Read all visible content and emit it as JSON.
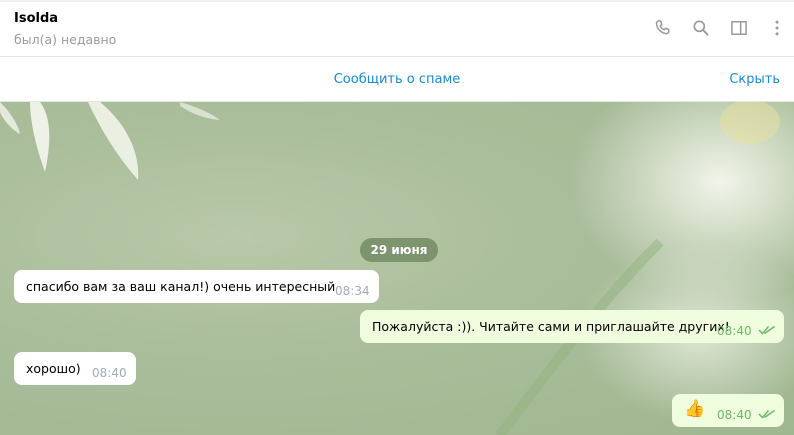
{
  "header": {
    "name": "Isolda",
    "status": "был(а) недавно",
    "icons": [
      "phone-icon",
      "search-icon",
      "sidebar-panel-icon",
      "more-vertical-icon"
    ]
  },
  "spam_bar": {
    "report_label": "Сообщить о спаме",
    "hide_label": "Скрыть"
  },
  "chat": {
    "date_label": "29 июня",
    "messages": [
      {
        "direction": "in",
        "text": "спасибо вам за ваш канал!) очень интересный",
        "time": "08:34"
      },
      {
        "direction": "out",
        "text": "Пожалуйста :)). Читайте сами и приглашайте других!",
        "time": "08:40",
        "read": true
      },
      {
        "direction": "in",
        "text": "хорошо)",
        "time": "08:40"
      },
      {
        "direction": "out",
        "text": "👍",
        "time": "08:40",
        "read": true,
        "emoji": "thumbs-up"
      }
    ]
  },
  "colors": {
    "link": "#168acd",
    "outgoing_bubble": "#effdde",
    "incoming_bubble": "#ffffff",
    "read_ticks": "#6cb86b"
  }
}
